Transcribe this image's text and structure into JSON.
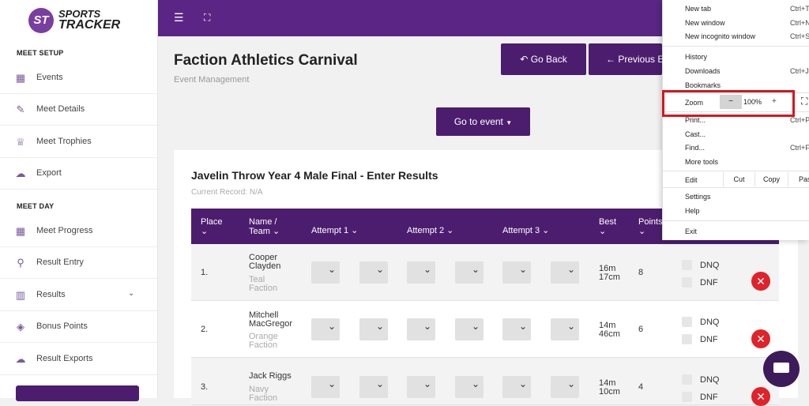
{
  "brand": {
    "logo_mark": "ST",
    "name_line1": "SPORTS",
    "name_line2": "TRACKER"
  },
  "sidebar": {
    "section_setup": "MEET SETUP",
    "setup_items": [
      {
        "label": "Events",
        "icon": "calendar-icon"
      },
      {
        "label": "Meet Details",
        "icon": "edit-icon"
      },
      {
        "label": "Meet Trophies",
        "icon": "trophy-icon"
      },
      {
        "label": "Export",
        "icon": "cloud-upload-icon"
      }
    ],
    "section_day": "MEET DAY",
    "day_items": [
      {
        "label": "Meet Progress",
        "icon": "grid-icon"
      },
      {
        "label": "Result Entry",
        "icon": "search-icon"
      },
      {
        "label": "Results",
        "icon": "bar-chart-icon"
      },
      {
        "label": "Bonus Points",
        "icon": "diamond-icon"
      },
      {
        "label": "Result Exports",
        "icon": "cloud-upload-icon"
      }
    ]
  },
  "header": {
    "title": "Faction Athletics Carnival",
    "subtitle": "Event Management",
    "go_back_label": "Go Back",
    "previous_label": "Previous E",
    "go_to_event_label": "Go to event"
  },
  "event": {
    "title": "Javelin Throw Year 4 Male Final - Enter Results",
    "record": "Current Record: N/A",
    "columns": {
      "place": "Place",
      "name_line1": "Name /",
      "name_line2": "Team",
      "attempt1": "Attempt 1",
      "attempt2": "Attempt 2",
      "attempt3": "Attempt 3",
      "best": "Best",
      "points": "Points"
    },
    "rows": [
      {
        "place": "1.",
        "first": "Cooper",
        "last": "Clayden",
        "team1": "Teal",
        "team2": "Faction",
        "best1": "16m",
        "best2": "17cm",
        "points": "8",
        "dnq": "DNQ",
        "dnf": "DNF"
      },
      {
        "place": "2.",
        "first": "Mitchell",
        "last": "MacGregor",
        "team1": "Orange",
        "team2": "Faction",
        "best1": "14m",
        "best2": "46cm",
        "points": "6",
        "dnq": "DNQ",
        "dnf": "DNF"
      },
      {
        "place": "3.",
        "first": "Jack Riggs",
        "last": "",
        "team1": "Navy",
        "team2": "Faction",
        "best1": "14m",
        "best2": "10cm",
        "points": "4",
        "dnq": "DNQ",
        "dnf": "DNF"
      }
    ]
  },
  "browser_menu": {
    "new_tab": "New tab",
    "new_tab_sc": "Ctrl+T",
    "new_window": "New window",
    "new_window_sc": "Ctrl+N",
    "incognito": "New incognito window",
    "incognito_sc": "Ctrl+Shift+N",
    "history": "History",
    "downloads": "Downloads",
    "downloads_sc": "Ctrl+J",
    "bookmarks": "Bookmarks",
    "zoom": "Zoom",
    "zoom_minus": "−",
    "zoom_value": "100%",
    "zoom_plus": "+",
    "print": "Print...",
    "print_sc": "Ctrl+P",
    "cast": "Cast...",
    "find": "Find...",
    "find_sc": "Ctrl+F",
    "more_tools": "More tools",
    "edit": "Edit",
    "cut": "Cut",
    "copy": "Copy",
    "paste": "Paste",
    "settings": "Settings",
    "help": "Help",
    "exit": "Exit"
  },
  "colors": {
    "primary": "#5a2584",
    "dark": "#4c1d6e",
    "delete": "#e0222a",
    "highlight": "#d6161e"
  }
}
